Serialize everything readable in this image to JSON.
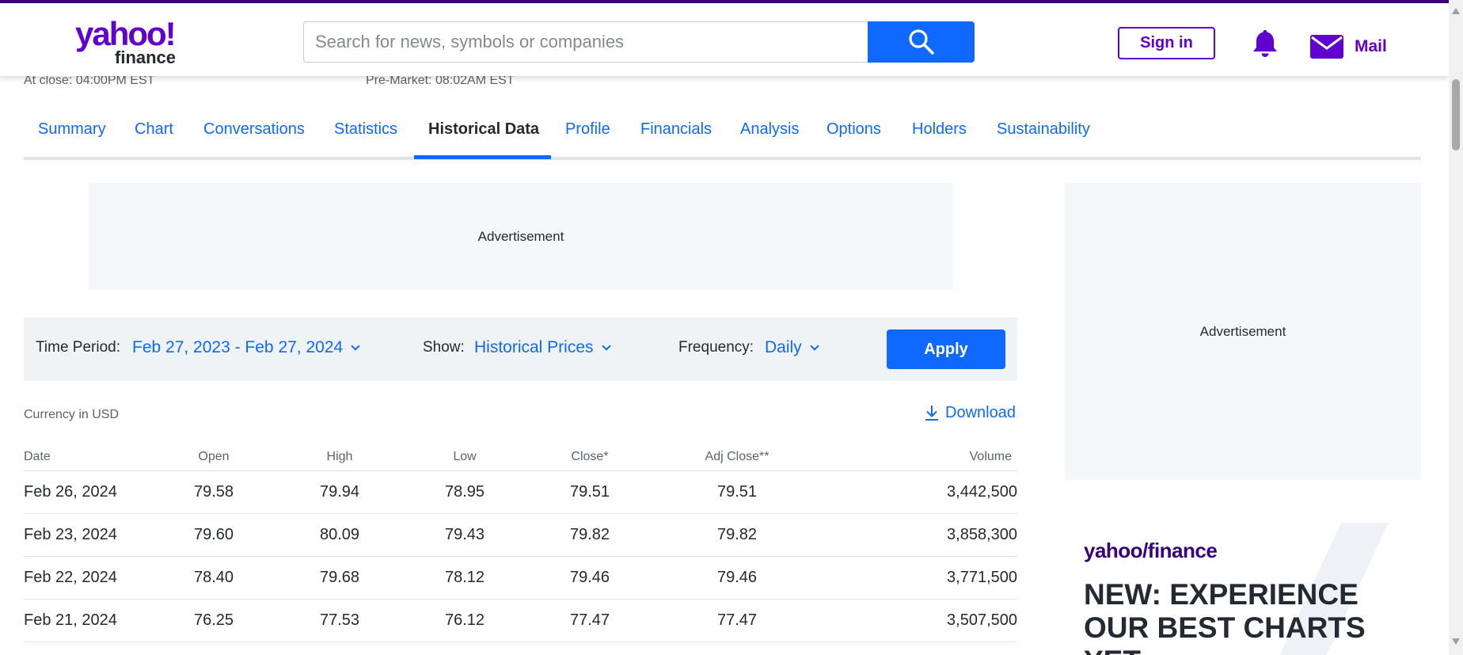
{
  "header": {
    "logo_text": "yahoo!",
    "logo_sub": "finance",
    "search_placeholder": "Search for news, symbols or companies",
    "sign_in": "Sign in",
    "mail": "Mail"
  },
  "quote": {
    "at_close": "At close: 04:00PM EST",
    "pre_market": "Pre-Market: 08:02AM EST"
  },
  "tabs": [
    {
      "label": "Summary"
    },
    {
      "label": "Chart"
    },
    {
      "label": "Conversations"
    },
    {
      "label": "Statistics"
    },
    {
      "label": "Historical Data",
      "active": true
    },
    {
      "label": "Profile"
    },
    {
      "label": "Financials"
    },
    {
      "label": "Analysis"
    },
    {
      "label": "Options"
    },
    {
      "label": "Holders"
    },
    {
      "label": "Sustainability"
    }
  ],
  "ads": {
    "top": "Advertisement",
    "side": "Advertisement"
  },
  "filters": {
    "time_period_label": "Time Period:",
    "time_period_value": "Feb 27, 2023 - Feb 27, 2024",
    "show_label": "Show:",
    "show_value": "Historical Prices",
    "frequency_label": "Frequency:",
    "frequency_value": "Daily",
    "apply": "Apply"
  },
  "currency_note": "Currency in USD",
  "download": "Download",
  "table": {
    "headers": [
      "Date",
      "Open",
      "High",
      "Low",
      "Close*",
      "Adj Close**",
      "Volume"
    ],
    "rows": [
      [
        "Feb 26, 2024",
        "79.58",
        "79.94",
        "78.95",
        "79.51",
        "79.51",
        "3,442,500"
      ],
      [
        "Feb 23, 2024",
        "79.60",
        "80.09",
        "79.43",
        "79.82",
        "79.82",
        "3,858,300"
      ],
      [
        "Feb 22, 2024",
        "78.40",
        "79.68",
        "78.12",
        "79.46",
        "79.46",
        "3,771,500"
      ],
      [
        "Feb 21, 2024",
        "76.25",
        "77.53",
        "76.12",
        "77.47",
        "77.47",
        "3,507,500"
      ]
    ]
  },
  "promo": {
    "logo": "yahoo/finance",
    "headline": "NEW: EXPERIENCE OUR BEST CHARTS YET."
  },
  "colors": {
    "brand_purple": "#6001d2",
    "accent_blue": "#0f69ff",
    "text_dark": "#232a31"
  }
}
